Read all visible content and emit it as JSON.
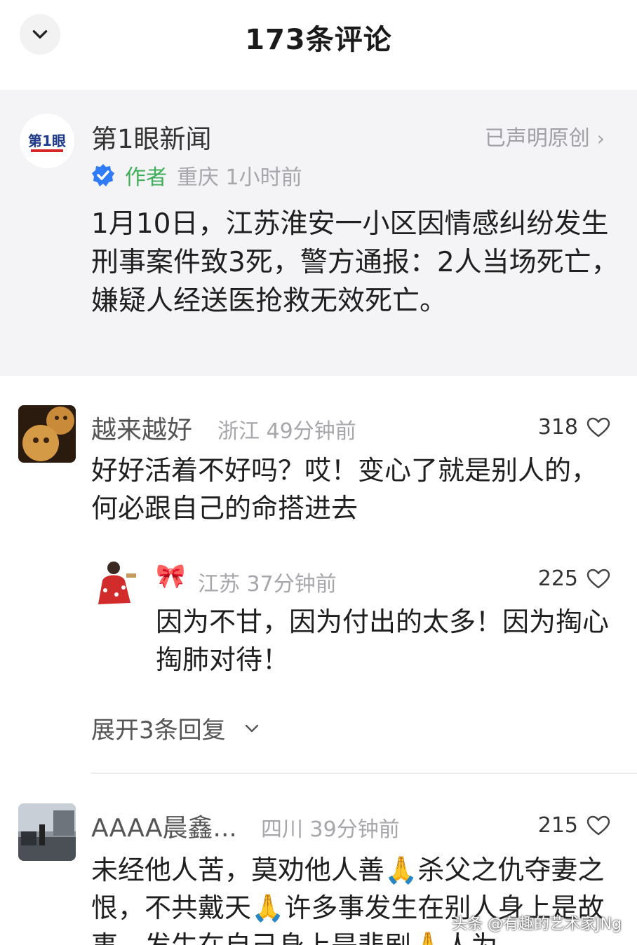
{
  "header": {
    "title": "173条评论",
    "back_icon": "chevron-down-icon"
  },
  "article": {
    "publisher": "第1眼新闻",
    "logo_text": "第1眼",
    "original_label": "已声明原创",
    "author_tag": "作者",
    "location_time": "重庆 1小时前",
    "text": "1月10日，江苏淮安一小区因情感纠纷发生刑事案件致3死，警方通报：2人当场死亡，嫌疑人经送医抢救无效死亡。"
  },
  "comments": [
    {
      "name": "越来越好",
      "meta": "浙江 49分钟前",
      "likes": "318",
      "text": "好好活着不好吗？哎！变心了就是别人的，何必跟自己的命搭进去"
    },
    {
      "name": "🎀",
      "meta": "江苏 37分钟前",
      "likes": "225",
      "text": "因为不甘，因为付出的太多！因为掏心掏肺对待！"
    },
    {
      "name": "AAAA晨鑫...",
      "meta": "四川 39分钟前",
      "likes": "215",
      "text": "未经他人苦，莫劝他人善🙏杀父之仇夺妻之恨，不共戴天🙏许多事发生在别人身上是故事，发生在自己身上是悲剧🙏人为"
    }
  ],
  "expand_replies": "展开3条回复",
  "watermark": "头条 @有趣的艺术家JNg",
  "colors": {
    "author_green": "#3fae5a",
    "verify_blue": "#2f7cf6",
    "muted": "#a6a6ab",
    "article_bg": "#f4f4f6"
  }
}
